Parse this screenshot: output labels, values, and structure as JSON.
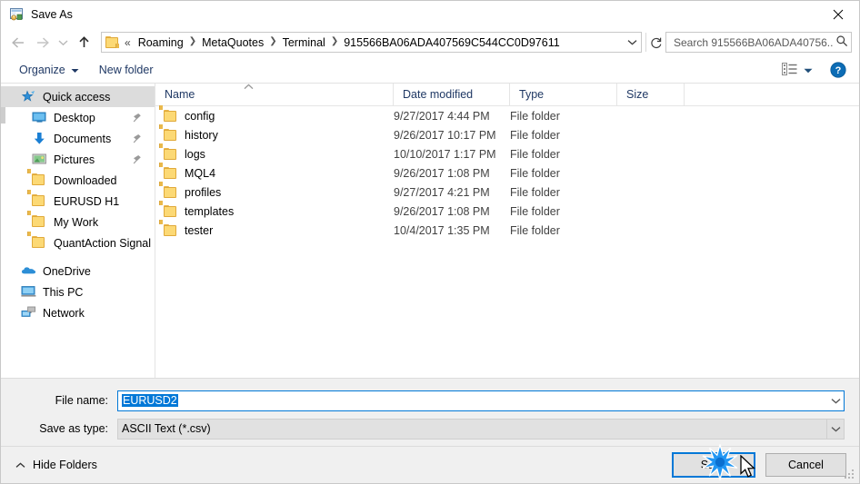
{
  "window": {
    "title": "Save As",
    "icon": "save-as-app-icon",
    "close_label": "✕"
  },
  "nav": {
    "back_icon": "arrow-left-icon",
    "forward_icon": "arrow-right-icon",
    "recent_icon": "chevron-down-icon",
    "up_icon": "arrow-up-icon",
    "overflow": "«",
    "separator": "❯",
    "breadcrumbs": [
      {
        "label": "Roaming"
      },
      {
        "label": "MetaQuotes"
      },
      {
        "label": "Terminal"
      },
      {
        "label": "915566BA06ADA407569C544CC0D97611"
      }
    ],
    "address_dropdown_icon": "chevron-down-icon",
    "refresh_icon": "refresh-icon"
  },
  "search": {
    "placeholder": "Search 915566BA06ADA40756...",
    "value": "",
    "icon": "search-icon"
  },
  "toolbar": {
    "organize_label": "Organize",
    "organize_caret": "▾",
    "new_folder_label": "New folder",
    "view_icon": "view-list-icon",
    "view_caret": "▾",
    "help_label": "?",
    "help_icon": "help-icon"
  },
  "sidebar": {
    "items": [
      {
        "label": "Quick access",
        "icon": "star-pin-icon",
        "selected": true,
        "level": 0,
        "pinned": false
      },
      {
        "label": "Desktop",
        "icon": "monitor-icon",
        "selected": false,
        "level": 1,
        "pinned": true
      },
      {
        "label": "Documents",
        "icon": "download-arrow-icon",
        "selected": false,
        "level": 1,
        "pinned": true
      },
      {
        "label": "Pictures",
        "icon": "picture-icon",
        "selected": false,
        "level": 1,
        "pinned": true
      },
      {
        "label": "Downloaded",
        "icon": "folder-icon",
        "selected": false,
        "level": 1,
        "pinned": false
      },
      {
        "label": "EURUSD H1",
        "icon": "folder-icon",
        "selected": false,
        "level": 1,
        "pinned": false
      },
      {
        "label": "My Work",
        "icon": "folder-icon",
        "selected": false,
        "level": 1,
        "pinned": false
      },
      {
        "label": "QuantAction Signal",
        "icon": "folder-icon",
        "selected": false,
        "level": 1,
        "pinned": false
      },
      {
        "label": "OneDrive",
        "icon": "cloud-icon",
        "selected": false,
        "level": 0,
        "pinned": false
      },
      {
        "label": "This PC",
        "icon": "computer-icon",
        "selected": false,
        "level": 0,
        "pinned": false
      },
      {
        "label": "Network",
        "icon": "network-icon",
        "selected": false,
        "level": 0,
        "pinned": false
      }
    ]
  },
  "filelist": {
    "columns": [
      {
        "label": "Name",
        "sorted": "asc"
      },
      {
        "label": "Date modified",
        "sorted": ""
      },
      {
        "label": "Type",
        "sorted": ""
      },
      {
        "label": "Size",
        "sorted": ""
      }
    ],
    "rows": [
      {
        "name": "config",
        "date": "9/27/2017 4:44 PM",
        "type": "File folder",
        "size": "",
        "icon": "folder-icon"
      },
      {
        "name": "history",
        "date": "9/26/2017 10:17 PM",
        "type": "File folder",
        "size": "",
        "icon": "folder-icon"
      },
      {
        "name": "logs",
        "date": "10/10/2017 1:17 PM",
        "type": "File folder",
        "size": "",
        "icon": "folder-icon"
      },
      {
        "name": "MQL4",
        "date": "9/26/2017 1:08 PM",
        "type": "File folder",
        "size": "",
        "icon": "folder-icon"
      },
      {
        "name": "profiles",
        "date": "9/27/2017 4:21 PM",
        "type": "File folder",
        "size": "",
        "icon": "folder-icon"
      },
      {
        "name": "templates",
        "date": "9/26/2017 1:08 PM",
        "type": "File folder",
        "size": "",
        "icon": "folder-icon"
      },
      {
        "name": "tester",
        "date": "10/4/2017 1:35 PM",
        "type": "File folder",
        "size": "",
        "icon": "folder-icon"
      }
    ]
  },
  "form": {
    "filename_label": "File name:",
    "filename_value": "EURUSD2",
    "filename_selected": true,
    "filetype_label": "Save as type:",
    "filetype_value": "ASCII Text (*.csv)",
    "dropdown_icon": "chevron-down-icon"
  },
  "footer": {
    "hide_folders_label": "Hide Folders",
    "hide_folders_caret": "⮝",
    "save_label": "Save",
    "cancel_label": "Cancel",
    "resize_grip_icon": "resize-grip-icon"
  },
  "colors": {
    "accent": "#0078d7",
    "folder": "#fcd975",
    "header_text": "#1f3864",
    "selection": "#dcdcdc",
    "window_bg": "#f0f0f0"
  },
  "pointer": {
    "cursor_icon": "mouse-cursor-icon",
    "click_burst_icon": "click-burst-icon"
  }
}
